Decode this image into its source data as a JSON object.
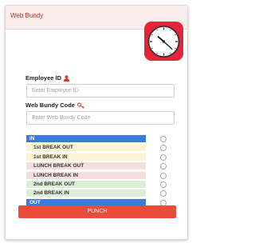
{
  "app": {
    "title": "Web Bundy"
  },
  "clock": {
    "hour": 10,
    "minute": 22,
    "face_color": "#ffffff",
    "box_color": "#e62439"
  },
  "form": {
    "employee_id": {
      "label": "Employee ID",
      "placeholder": "Enter Employee ID",
      "value": ""
    },
    "bundy_code": {
      "label": "Web Bundy Code",
      "placeholder": "Enter Web Bundy Code",
      "value": ""
    }
  },
  "options": [
    {
      "label": "IN",
      "bg": "#3a7bdc",
      "fg": "#ffffff",
      "selected": false
    },
    {
      "label": "1st BREAK OUT",
      "bg": "#fcf3d5",
      "fg": "#333333",
      "selected": false
    },
    {
      "label": "1st BREAK IN",
      "bg": "#fcf3d5",
      "fg": "#333333",
      "selected": false
    },
    {
      "label": "LUNCH BREAK OUT",
      "bg": "#f5dede",
      "fg": "#333333",
      "selected": false
    },
    {
      "label": "LUNCH BREAK IN",
      "bg": "#f5dede",
      "fg": "#333333",
      "selected": false
    },
    {
      "label": "2nd BREAK OUT",
      "bg": "#dcefd6",
      "fg": "#333333",
      "selected": false
    },
    {
      "label": "2nd BREAK IN",
      "bg": "#dcefd6",
      "fg": "#333333",
      "selected": false
    },
    {
      "label": "OUT",
      "bg": "#3a7bdc",
      "fg": "#ffffff",
      "selected": false
    }
  ],
  "actions": {
    "punch_label": "PUNCH"
  },
  "colors": {
    "accent": "#e84d3b",
    "title_text": "#b3312a",
    "header_bg": "#fbecec"
  }
}
